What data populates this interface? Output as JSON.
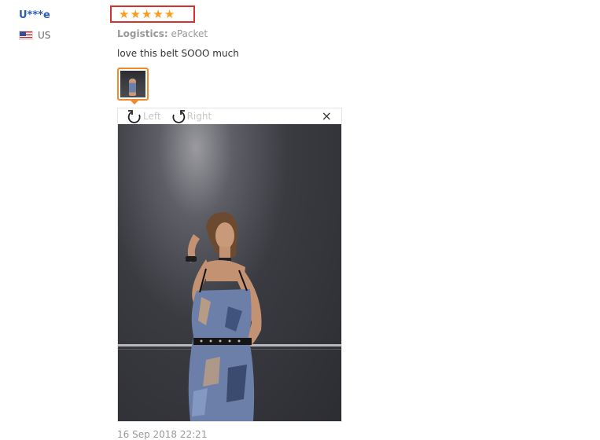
{
  "reviewer": {
    "name": "U***e",
    "country": "US"
  },
  "review": {
    "rating": 5,
    "logistics_label": "Logistics:",
    "logistics_value": "ePacket",
    "text": "love this belt SOOO much",
    "date": "16 Sep 2018 22:21"
  },
  "viewer": {
    "rotate_left_label": "Left",
    "rotate_right_label": "Right",
    "close_symbol": "×"
  },
  "icons": {
    "star": "star-icon",
    "rotate_left": "rotate-left-icon",
    "rotate_right": "rotate-right-icon",
    "close": "close-icon",
    "flag": "us-flag-icon"
  },
  "colors": {
    "rating_highlight": "#d9302e",
    "star": "#ff9a1a",
    "username": "#2a5bb8",
    "thumb_border": "#f08a2c"
  }
}
